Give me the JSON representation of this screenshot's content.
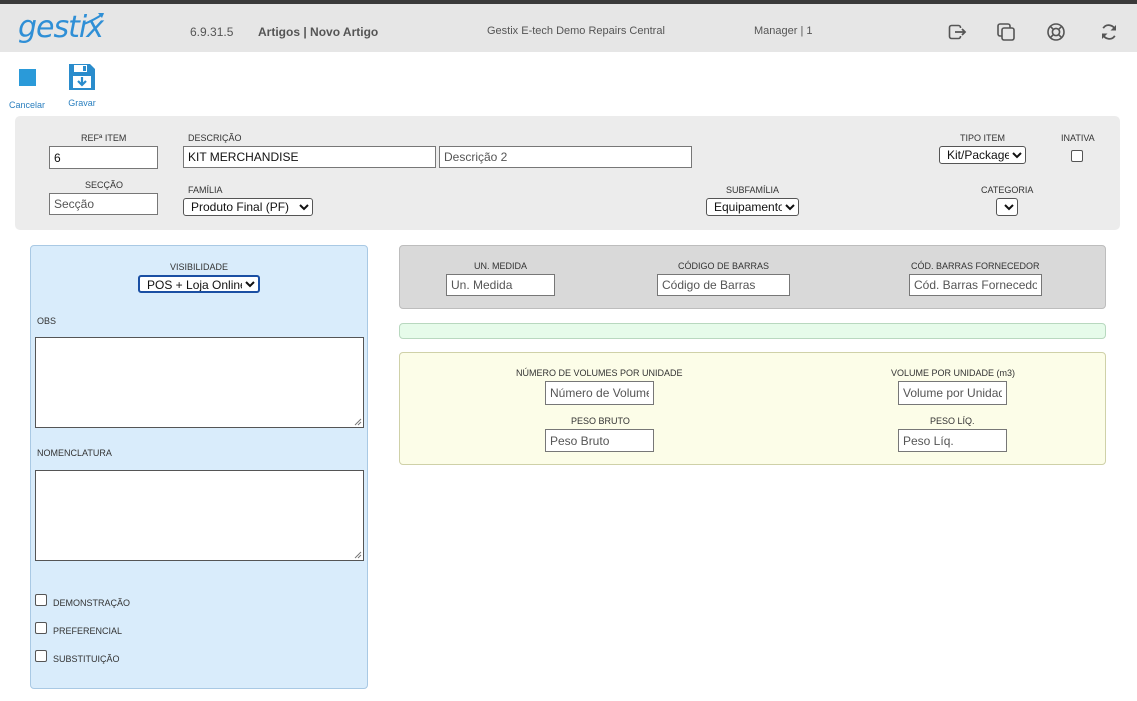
{
  "header": {
    "logo": "gestix",
    "version": "6.9.31.5",
    "breadcrumb": "Artigos | Novo Artigo",
    "company": "Gestix E-tech Demo Repairs Central",
    "user": "Manager | 1",
    "icons": [
      "logout-icon",
      "windows-icon",
      "help-lifebuoy-icon",
      "refresh-icon"
    ]
  },
  "toolbar": {
    "cancel_label": "Cancelar",
    "save_label": "Gravar"
  },
  "colors": {
    "brand": "#2f8fd6",
    "header_bg": "#e6e6e6",
    "left_panel_bg": "#d9ecfb",
    "barcode_panel_bg": "#d9d9d9",
    "green_panel_bg": "#e6fbea",
    "yellow_panel_bg": "#fcfde8"
  },
  "form": {
    "ref_label": "Refª Item",
    "ref_value": "6",
    "descricao_label": "Descrição",
    "descricao_value": "KIT MERCHANDISE",
    "descricao2_placeholder": "Descrição 2",
    "tipo_label": "Tipo Item",
    "tipo_value": "Kit/Package",
    "inativa_label": "Inativa",
    "inativa_checked": false,
    "seccao_label": "Secção",
    "seccao_placeholder": "Secção",
    "familia_label": "Família",
    "familia_value": "Produto Final (PF)",
    "subfamilia_label": "Subfamília",
    "subfamilia_value": "Equipamento",
    "categoria_label": "Categoria",
    "categoria_value": ""
  },
  "left": {
    "visibilidade_label": "Visibilidade",
    "visibilidade_value": "POS + Loja Online",
    "obs_label": "OBS",
    "nomenclatura_label": "Nomenclatura",
    "checkboxes": [
      {
        "label": "Demonstração",
        "checked": false
      },
      {
        "label": "Preferencial",
        "checked": false
      },
      {
        "label": "Substituição",
        "checked": false
      }
    ]
  },
  "barcode": {
    "un_medida_label": "Un. Medida",
    "un_medida_placeholder": "Un. Medida",
    "codigo_barras_label": "Código de Barras",
    "codigo_barras_placeholder": "Código de Barras",
    "cod_fornecedor_label": "Cód. Barras Fornecedor",
    "cod_fornecedor_placeholder": "Cód. Barras Fornecedor"
  },
  "volumes": {
    "num_volumes_label": "Número de Volumes por Unidade",
    "num_volumes_placeholder": "Número de Volumes por Unidade",
    "volume_unidade_label": "Volume por Unidade",
    "volume_unidade_unit": "(m3)",
    "volume_unidade_placeholder": "Volume por Unidade",
    "peso_bruto_label": "Peso Bruto",
    "peso_bruto_placeholder": "Peso Bruto",
    "peso_liq_label": "Peso Líq.",
    "peso_liq_placeholder": "Peso Líq."
  }
}
